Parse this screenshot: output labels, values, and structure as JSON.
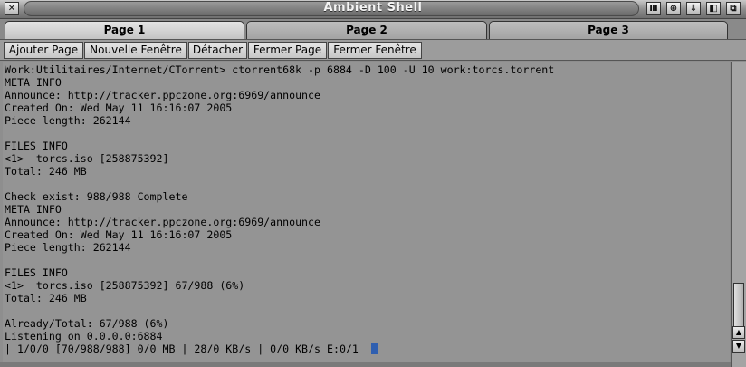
{
  "window": {
    "title": "Ambient Shell",
    "title_buttons": [
      {
        "name": "close-icon",
        "glyph": "✕"
      },
      {
        "name": "iconify-icon",
        "glyph": "Ⅲ"
      },
      {
        "name": "snapshot-icon",
        "glyph": "⊕"
      },
      {
        "name": "minimize-icon",
        "glyph": "⇓"
      },
      {
        "name": "zoom-icon",
        "glyph": "◧"
      },
      {
        "name": "depth-icon",
        "glyph": "⧉"
      }
    ]
  },
  "tabs": [
    {
      "label": "Page 1",
      "active": true
    },
    {
      "label": "Page 2",
      "active": false
    },
    {
      "label": "Page 3",
      "active": false
    }
  ],
  "toolbar": {
    "buttons": [
      "Ajouter Page",
      "Nouvelle Fenêtre",
      "Détacher",
      "Fermer Page",
      "Fermer Fenêtre"
    ]
  },
  "console": {
    "lines": [
      "Work:Utilitaires/Internet/CTorrent> ctorrent68k -p 6884 -D 100 -U 10 work:torcs.torrent",
      "META INFO",
      "Announce: http://tracker.ppczone.org:6969/announce",
      "Created On: Wed May 11 16:16:07 2005",
      "Piece length: 262144",
      "",
      "FILES INFO",
      "<1>  torcs.iso [258875392]",
      "Total: 246 MB",
      "",
      "Check exist: 988/988 Complete",
      "META INFO",
      "Announce: http://tracker.ppczone.org:6969/announce",
      "Created On: Wed May 11 16:16:07 2005",
      "Piece length: 262144",
      "",
      "FILES INFO",
      "<1>  torcs.iso [258875392] 67/988 (6%)",
      "Total: 246 MB",
      "",
      "Already/Total: 67/988 (6%)",
      "Listening on 0.0.0.0:6884",
      "| 1/0/0 [70/988/988] 0/0 MB | 28/0 KB/s | 0/0 KB/s E:0/1  "
    ]
  },
  "colors": {
    "cursor": "#2f5fb0",
    "console_bg": "#949494"
  }
}
